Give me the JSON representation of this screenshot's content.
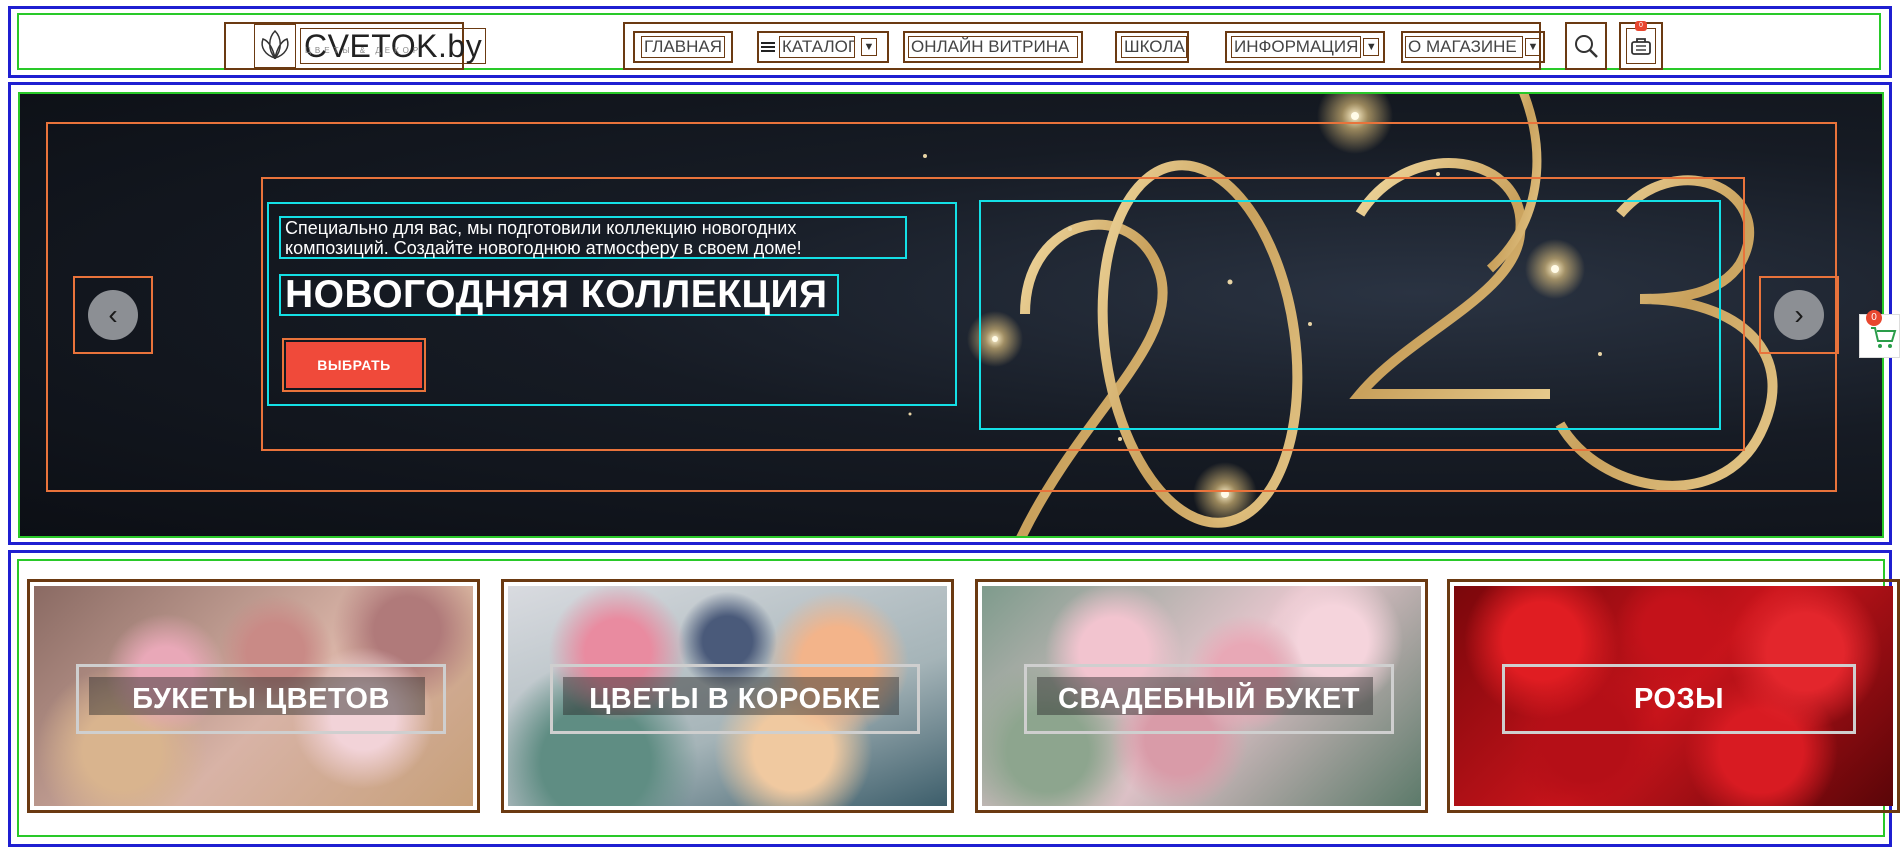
{
  "header": {
    "logo": {
      "text": "CVETOK.by",
      "subtext": "ЦВЕТЫ & ДЕКОР"
    },
    "nav": [
      {
        "label": "ГЛАВНАЯ"
      },
      {
        "label": "КАТАЛОГ"
      },
      {
        "label": "ОНЛАЙН ВИТРИНА"
      },
      {
        "label": "ШКОЛА"
      },
      {
        "label": "ИНФОРМАЦИЯ"
      },
      {
        "label": "О МАГАЗИНЕ"
      }
    ],
    "cart_count": "0"
  },
  "hero": {
    "subtitle": "Специально для вас, мы подготовили коллекцию новогодних композиций. Создайте новогоднюю атмосферу в своем доме!",
    "title": "НОВОГОДНЯЯ КОЛЛЕКЦИЯ",
    "cta_label": "ВЫБРАТЬ",
    "year_text": "2023",
    "prev_icon": "chevron-left-icon",
    "next_icon": "chevron-right-icon"
  },
  "side_cart": {
    "count": "0"
  },
  "categories": [
    {
      "label": "БУКЕТЫ ЦВЕТОВ"
    },
    {
      "label": "ЦВЕТЫ В КОРОБКЕ"
    },
    {
      "label": "СВАДЕБНЫЙ БУКЕТ"
    },
    {
      "label": "РОЗЫ"
    }
  ],
  "colors": {
    "accent": "#f04a3a",
    "gold": "#d8b878",
    "hero_bg": "#12161d"
  }
}
